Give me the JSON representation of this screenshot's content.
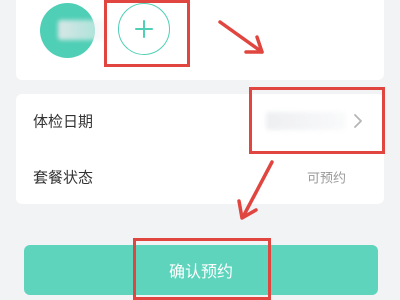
{
  "colors": {
    "accent": "#4fcfb6",
    "button": "#5fd4bd",
    "highlight": "#e0463f",
    "label": "#333333",
    "muted": "#999999"
  },
  "members": {
    "add_icon": "plus-icon"
  },
  "form": {
    "date_label": "体检日期",
    "status_label": "套餐状态",
    "status_value": "可预约",
    "chevron_icon": "chevron-right-icon"
  },
  "actions": {
    "confirm_label": "确认预约"
  }
}
